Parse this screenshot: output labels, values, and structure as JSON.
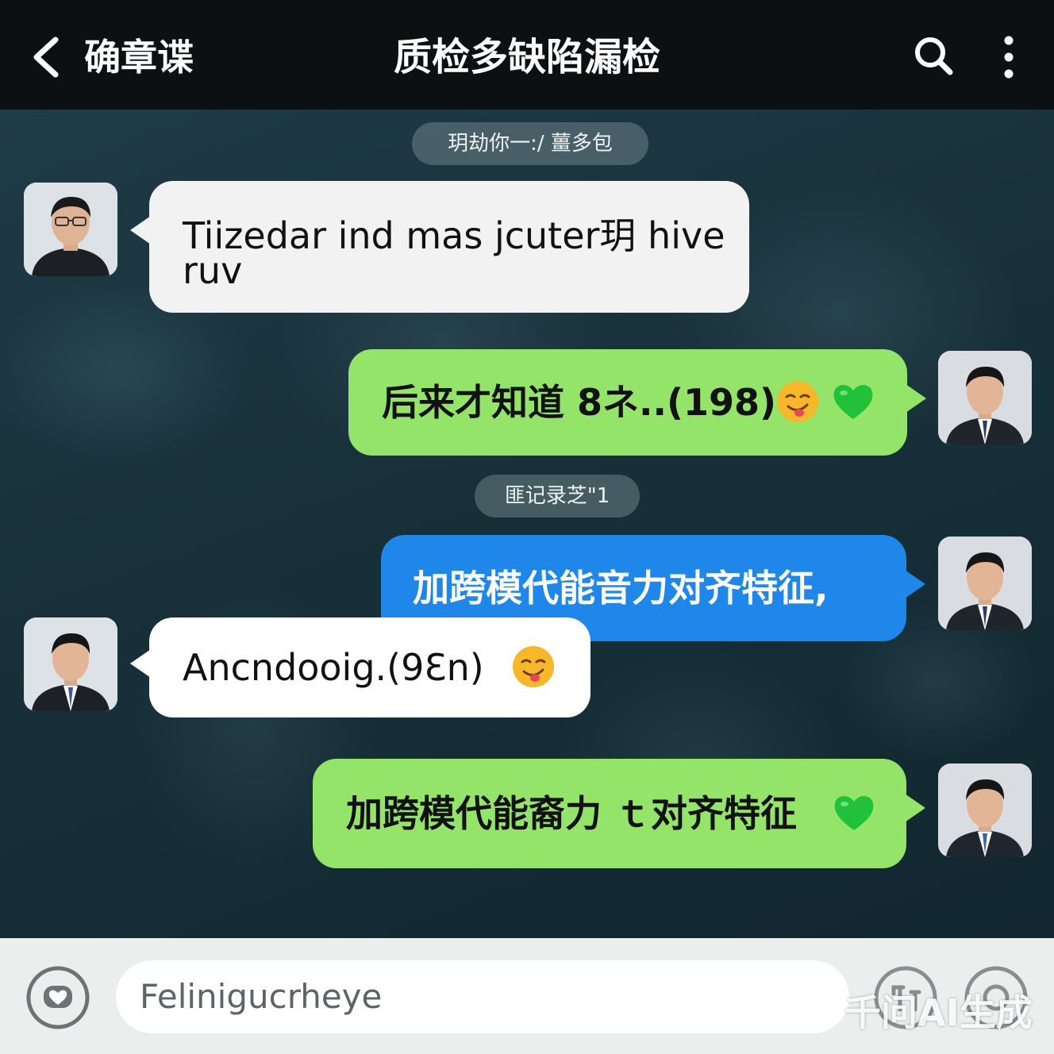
{
  "header": {
    "back_label": "确章谍",
    "title": "质检多缺陷漏检"
  },
  "chat": {
    "system_pills": [
      {
        "text": "玥劫你一:/ 薑多包"
      },
      {
        "text": "匪记录芝\"1"
      }
    ],
    "messages": [
      {
        "side": "left",
        "color": "#f2f2f2",
        "line1": "Tiizedar ind mas jcuter玥 hive",
        "line2": "ruv"
      },
      {
        "side": "right",
        "color": "#95e46a",
        "text": "后来才知道 8ネ..(198)",
        "emojis": [
          "smirk-face",
          "green-heart"
        ]
      },
      {
        "side": "right",
        "color": "#1f86ea",
        "text": "加跨模代能音力对齐特征,"
      },
      {
        "side": "left",
        "color": "#ffffff",
        "text": "Ancndooig.(9Ɛn)",
        "emojis": [
          "smirk-face"
        ]
      },
      {
        "side": "right",
        "color": "#95e46a",
        "text": "加跨模代能裔力 ｔ对齐特征",
        "emojis": [
          "green-heart"
        ]
      }
    ]
  },
  "composer": {
    "input_value": "Feliniguсrheye"
  },
  "watermark": "千问AI生成",
  "colors": {
    "green_bubble": "#95e46a",
    "blue_bubble": "#1f86ea",
    "white_bubble": "#f2f2f2",
    "topbar": "#0c1012",
    "bottombar": "#eceeee"
  }
}
